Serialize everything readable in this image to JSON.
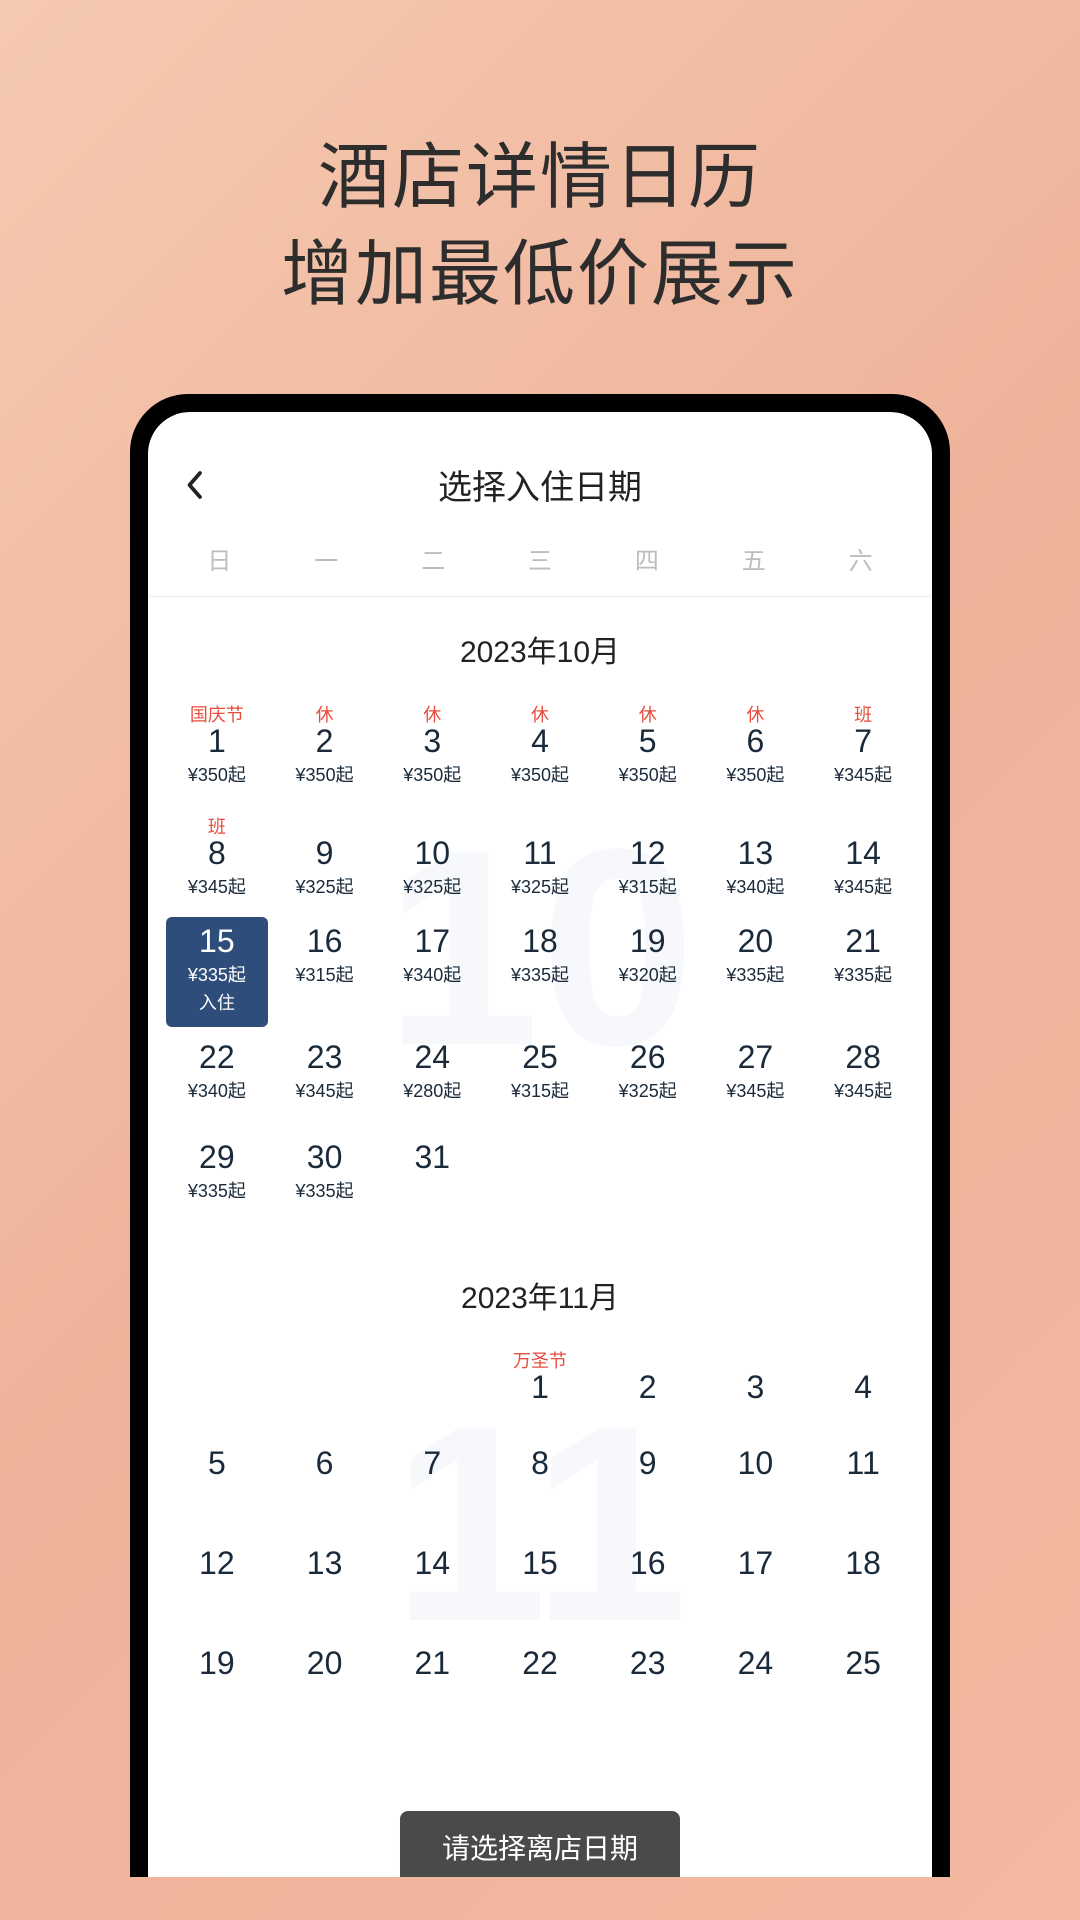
{
  "promo": {
    "line1": "酒店详情日历",
    "line2": "增加最低价展示"
  },
  "header": {
    "title": "选择入住日期"
  },
  "weekdays": [
    "日",
    "一",
    "二",
    "三",
    "四",
    "五",
    "六"
  ],
  "months": [
    {
      "title": "2023年10月",
      "bg": "10",
      "startDay": 0,
      "days": [
        {
          "num": "1",
          "label": "国庆节",
          "price": "¥350起"
        },
        {
          "num": "2",
          "label": "休",
          "price": "¥350起"
        },
        {
          "num": "3",
          "label": "休",
          "price": "¥350起"
        },
        {
          "num": "4",
          "label": "休",
          "price": "¥350起"
        },
        {
          "num": "5",
          "label": "休",
          "price": "¥350起"
        },
        {
          "num": "6",
          "label": "休",
          "price": "¥350起"
        },
        {
          "num": "7",
          "label": "班",
          "price": "¥345起"
        },
        {
          "num": "8",
          "label": "班",
          "price": "¥345起"
        },
        {
          "num": "9",
          "price": "¥325起"
        },
        {
          "num": "10",
          "price": "¥325起"
        },
        {
          "num": "11",
          "price": "¥325起"
        },
        {
          "num": "12",
          "price": "¥315起"
        },
        {
          "num": "13",
          "price": "¥340起"
        },
        {
          "num": "14",
          "price": "¥345起"
        },
        {
          "num": "15",
          "price": "¥335起",
          "selected": true,
          "checkin": "入住"
        },
        {
          "num": "16",
          "price": "¥315起"
        },
        {
          "num": "17",
          "price": "¥340起"
        },
        {
          "num": "18",
          "price": "¥335起"
        },
        {
          "num": "19",
          "price": "¥320起"
        },
        {
          "num": "20",
          "price": "¥335起"
        },
        {
          "num": "21",
          "price": "¥335起"
        },
        {
          "num": "22",
          "price": "¥340起"
        },
        {
          "num": "23",
          "price": "¥345起"
        },
        {
          "num": "24",
          "price": "¥280起"
        },
        {
          "num": "25",
          "price": "¥315起"
        },
        {
          "num": "26",
          "price": "¥325起"
        },
        {
          "num": "27",
          "price": "¥345起"
        },
        {
          "num": "28",
          "price": "¥345起"
        },
        {
          "num": "29",
          "price": "¥335起"
        },
        {
          "num": "30",
          "price": "¥335起"
        },
        {
          "num": "31"
        }
      ]
    },
    {
      "title": "2023年11月",
      "bg": "11",
      "startDay": 3,
      "days": [
        {
          "num": "1",
          "label": "万圣节"
        },
        {
          "num": "2"
        },
        {
          "num": "3"
        },
        {
          "num": "4"
        },
        {
          "num": "5"
        },
        {
          "num": "6"
        },
        {
          "num": "7"
        },
        {
          "num": "8"
        },
        {
          "num": "9"
        },
        {
          "num": "10"
        },
        {
          "num": "11"
        },
        {
          "num": "12"
        },
        {
          "num": "13"
        },
        {
          "num": "14"
        },
        {
          "num": "15"
        },
        {
          "num": "16"
        },
        {
          "num": "17"
        },
        {
          "num": "18"
        },
        {
          "num": "19"
        },
        {
          "num": "20"
        },
        {
          "num": "21"
        },
        {
          "num": "22"
        },
        {
          "num": "23"
        },
        {
          "num": "24"
        },
        {
          "num": "25"
        }
      ]
    }
  ],
  "toast": "请选择离店日期"
}
